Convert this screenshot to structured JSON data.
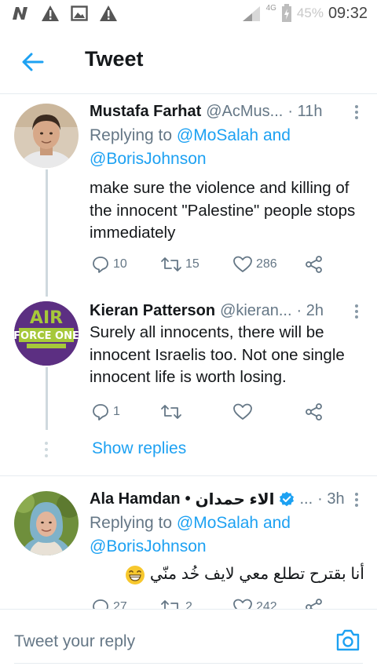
{
  "status_bar": {
    "network": "4G",
    "battery_percent": "45%",
    "time": "09:32",
    "icons": [
      "n-logo-icon",
      "warning-icon",
      "image-icon",
      "warning-icon",
      "signal-icon",
      "battery-icon"
    ]
  },
  "header": {
    "title": "Tweet",
    "back_icon": "arrow-left-icon"
  },
  "tweets": [
    {
      "name": "Mustafa Farhat",
      "handle": "@AcMus...",
      "time": "· 11h",
      "replying_prefix": "Replying to",
      "replying_to_1": "@MoSalah",
      "replying_and": "and",
      "replying_to_2": "@BorisJohnson",
      "text": "make sure the violence and killing of the innocent \"Palestine\" people stops immediately",
      "replies": "10",
      "retweets": "15",
      "likes": "286"
    },
    {
      "name": "Kieran Patterson",
      "handle": "@kieran...",
      "time": "· 2h",
      "text": "Surely all innocents, there will be innocent Israelis too. Not one single innocent life is worth losing.",
      "replies": "1",
      "retweets": "",
      "likes": "",
      "avatar_text_top": "AIR",
      "avatar_text_mid": "FORCE ONE"
    },
    {
      "name": "Ala Hamdan",
      "name_separator": "•",
      "name_arabic": "الاء حمدان",
      "handle": "...",
      "time": "· 3h",
      "replying_prefix": "Replying to",
      "replying_to_1": "@MoSalah",
      "replying_and": "and",
      "replying_to_2": "@BorisJohnson",
      "text": "أنا بقترح تطلع معي لايف خُد منّي",
      "replies": "27",
      "retweets": "2",
      "likes": "242"
    }
  ],
  "show_replies_label": "Show replies",
  "composer": {
    "placeholder": "Tweet your reply",
    "camera_icon": "camera-icon"
  },
  "colors": {
    "accent": "#1da1f2",
    "secondary_text": "#657786",
    "primary_text": "#14171a",
    "divider": "#e6ecf0"
  }
}
